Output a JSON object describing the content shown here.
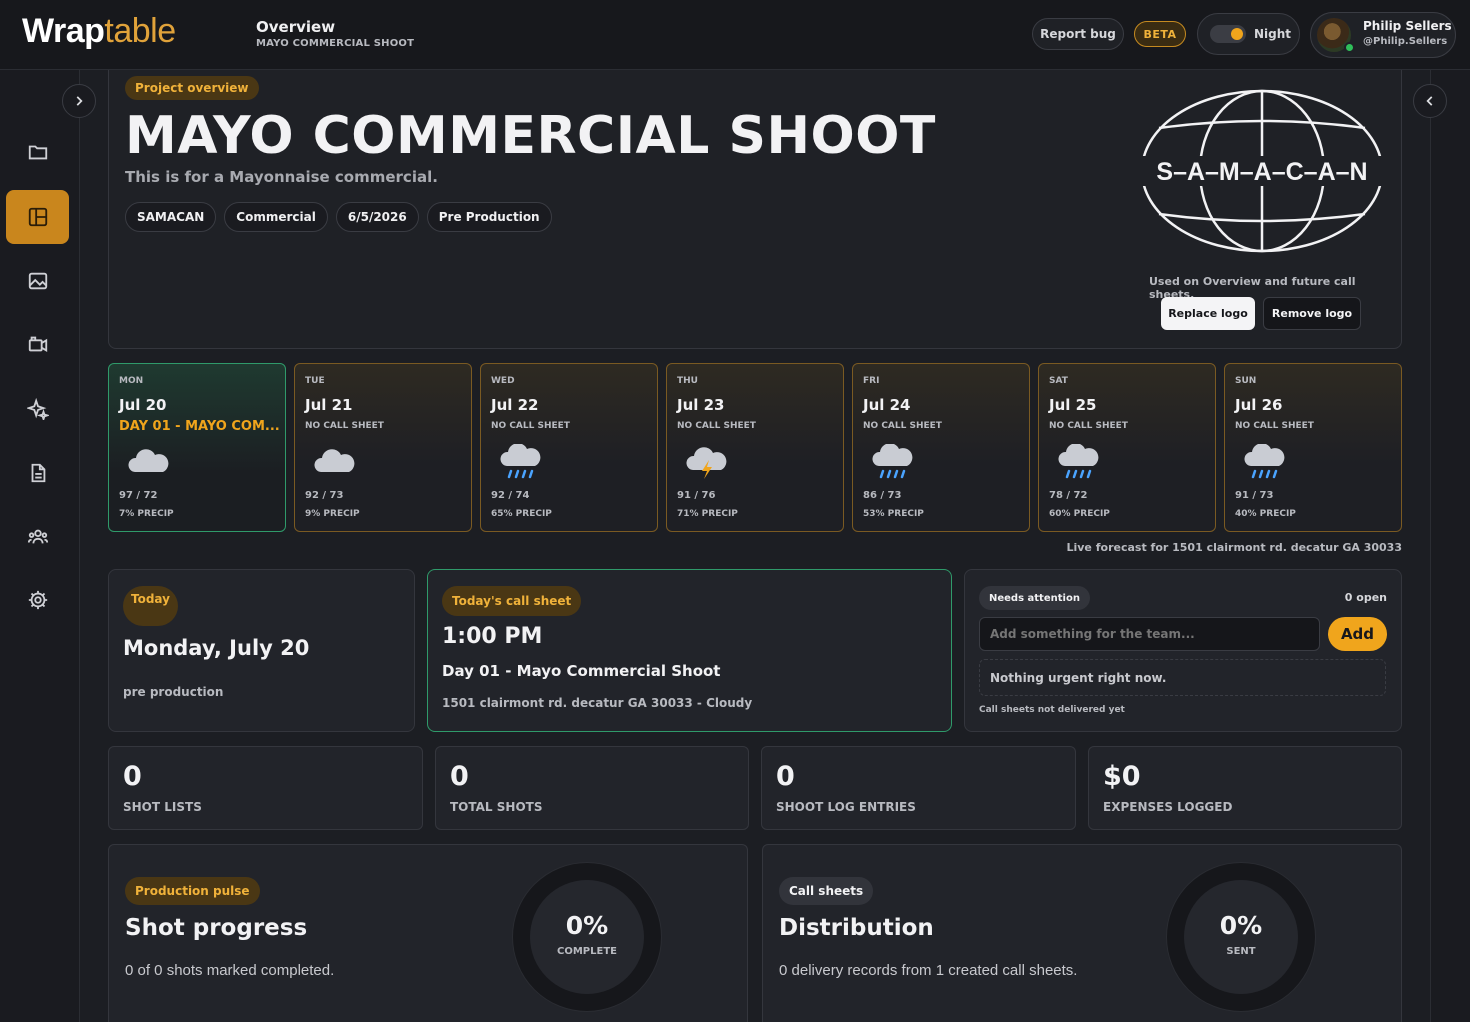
{
  "header": {
    "logo_main": "Wrap",
    "logo_accent": "table",
    "title": "Overview",
    "subtitle": "MAYO COMMERCIAL SHOOT",
    "report_bug": "Report bug",
    "beta": "BETA",
    "theme_label": "Night",
    "user_name": "Philip Sellers",
    "user_handle": "@Philip.Sellers"
  },
  "sidebar": {
    "items": [
      {
        "name": "projects",
        "icon": "folder-icon"
      },
      {
        "name": "overview",
        "icon": "dashboard-icon",
        "active": true
      },
      {
        "name": "images",
        "icon": "image-icon"
      },
      {
        "name": "camera",
        "icon": "camera-icon"
      },
      {
        "name": "ai",
        "icon": "sparkle-icon"
      },
      {
        "name": "documents",
        "icon": "document-icon"
      },
      {
        "name": "team",
        "icon": "team-icon"
      },
      {
        "name": "settings",
        "icon": "gear-icon"
      }
    ]
  },
  "project": {
    "tag": "Project overview",
    "title": "MAYO COMMERCIAL SHOOT",
    "description": "This is for a Mayonnaise commercial.",
    "chips": [
      "SAMACAN",
      "Commercial",
      "6/5/2026",
      "Pre Production"
    ],
    "logo_text": "S–A–M–A–C–A–N",
    "logo_note": "Used on Overview and future call sheets.",
    "replace_logo": "Replace logo",
    "remove_logo": "Remove logo"
  },
  "forecast": {
    "days": [
      {
        "dow": "MON",
        "date": "Jul 20",
        "note": "DAY 01 - MAYO COM...",
        "icon": "cloud-icon",
        "temp": "97 / 72",
        "precip": "7% PRECIP",
        "today": true
      },
      {
        "dow": "TUE",
        "date": "Jul 21",
        "note": "NO CALL SHEET",
        "icon": "cloud-icon",
        "temp": "92 / 73",
        "precip": "9% PRECIP"
      },
      {
        "dow": "WED",
        "date": "Jul 22",
        "note": "NO CALL SHEET",
        "icon": "rain-icon",
        "temp": "92 / 74",
        "precip": "65% PRECIP"
      },
      {
        "dow": "THU",
        "date": "Jul 23",
        "note": "NO CALL SHEET",
        "icon": "storm-icon",
        "temp": "91 / 76",
        "precip": "71% PRECIP"
      },
      {
        "dow": "FRI",
        "date": "Jul 24",
        "note": "NO CALL SHEET",
        "icon": "rain-icon",
        "temp": "86 / 73",
        "precip": "53% PRECIP"
      },
      {
        "dow": "SAT",
        "date": "Jul 25",
        "note": "NO CALL SHEET",
        "icon": "rain-icon",
        "temp": "78 / 72",
        "precip": "60% PRECIP"
      },
      {
        "dow": "SUN",
        "date": "Jul 26",
        "note": "NO CALL SHEET",
        "icon": "rain-icon",
        "temp": "91 / 73",
        "precip": "40% PRECIP"
      }
    ],
    "note": "Live forecast for 1501 clairmont rd. decatur GA 30033"
  },
  "today": {
    "tag": "Today",
    "date": "Monday, July 20",
    "phase": "pre production"
  },
  "call_sheet": {
    "tag": "Today's call sheet",
    "time": "1:00 PM",
    "name": "Day 01 - Mayo Commercial Shoot",
    "location": "1501 clairmont rd. decatur GA 30033 - Cloudy"
  },
  "attention": {
    "tag": "Needs attention",
    "open_count": "0 open",
    "placeholder": "Add something for the team...",
    "add": "Add",
    "empty": "Nothing urgent right now.",
    "footer": "Call sheets not delivered yet"
  },
  "stats": [
    {
      "value": "0",
      "label": "SHOT LISTS"
    },
    {
      "value": "0",
      "label": "TOTAL SHOTS"
    },
    {
      "value": "0",
      "label": "SHOOT LOG ENTRIES"
    },
    {
      "value": "$0",
      "label": "EXPENSES LOGGED"
    }
  ],
  "pulse": {
    "tag": "Production pulse",
    "title": "Shot progress",
    "text": "0 of 0 shots marked completed.",
    "ring_value": "0%",
    "ring_label": "COMPLETE",
    "progress": 0
  },
  "distribution": {
    "tag": "Call sheets",
    "title": "Distribution",
    "text": "0 delivery records from 1 created call sheets.",
    "ring_value": "0%",
    "ring_label": "SENT",
    "progress": 0
  },
  "colors": {
    "accent": "#f0a51c",
    "active_nav": "#c9861d",
    "today_border": "#2f9a6a",
    "day_border": "#7a5a22"
  }
}
